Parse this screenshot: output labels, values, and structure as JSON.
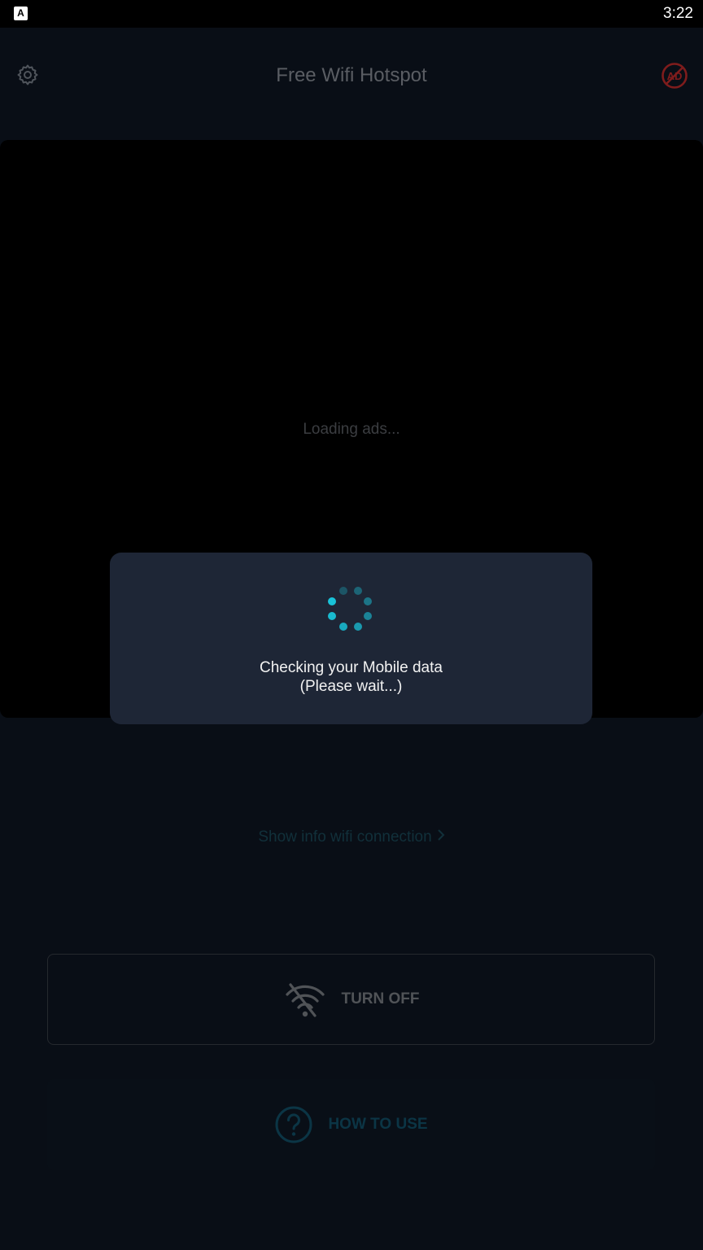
{
  "status_bar": {
    "app_icon_letter": "A",
    "time": "3:22"
  },
  "app_bar": {
    "title": "Free Wifi Hotspot",
    "settings_icon": "gear-icon",
    "no_ads_icon": "no-ad-icon",
    "no_ads_label": "AD"
  },
  "ad": {
    "loading_text": "Loading ads..."
  },
  "info_link": {
    "label": "Show info wifi connection"
  },
  "turn_off": {
    "label": "TURN OFF",
    "icon": "wifi-off-icon"
  },
  "how_to_use": {
    "label": "HOW TO USE",
    "icon": "question-circle-icon"
  },
  "dialog": {
    "line1": "Checking your Mobile data",
    "line2": "(Please wait...)",
    "spinner_icon": "loading-spinner-icon"
  },
  "colors": {
    "accent": "#19c2d8",
    "no_ad_red": "#c42c2c",
    "background": "#0e1622",
    "dialog": "#1e2636"
  }
}
